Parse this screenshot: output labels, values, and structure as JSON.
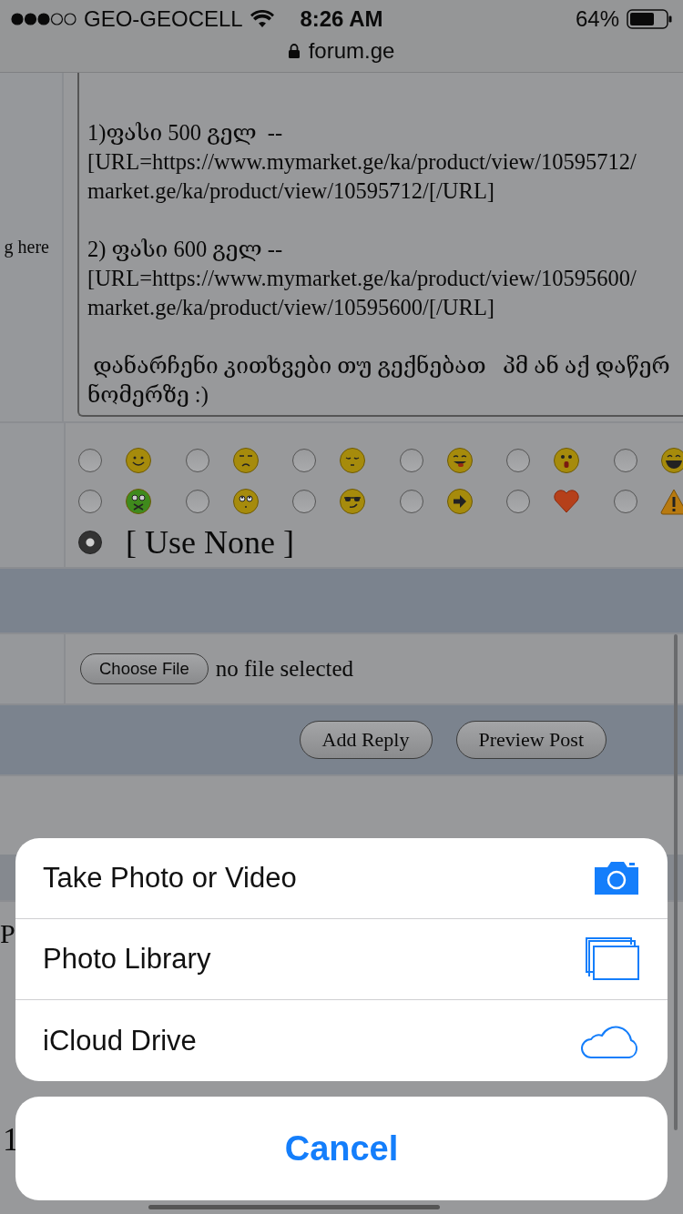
{
  "status_bar": {
    "carrier": "GEO-GEOCELL",
    "time": "8:26 AM",
    "battery": "64%",
    "url": "forum.ge"
  },
  "post_form": {
    "side_label": "g here",
    "message_lines": [
      {
        "kind": "blank"
      },
      {
        "kind": "line",
        "text": "1)ფასი 500 გელ  --"
      },
      {
        "kind": "line",
        "text": "[URL=https://www.mymarket.ge/ka/product/view/10595712/"
      },
      {
        "kind": "line",
        "text": "market.ge/ka/product/view/10595712/[/URL]"
      },
      {
        "kind": "blank"
      },
      {
        "kind": "line",
        "text": "2) ფასი 600 გელ --"
      },
      {
        "kind": "line",
        "text": "[URL=https://www.mymarket.ge/ka/product/view/10595600/"
      },
      {
        "kind": "line",
        "text": "market.ge/ka/product/view/10595600/[/URL]"
      },
      {
        "kind": "blank"
      },
      {
        "kind": "line",
        "text": " დანარჩენი კითხვები თუ გექნებათ   პმ ან აქ დაწერ"
      },
      {
        "kind": "line",
        "text": "ნომერზე :)"
      }
    ],
    "emoticons": [
      {
        "kind": "smile",
        "selected": false
      },
      {
        "kind": "frown",
        "selected": false
      },
      {
        "kind": "sleepy",
        "selected": false
      },
      {
        "kind": "tongue",
        "selected": false
      },
      {
        "kind": "shocked",
        "selected": false
      },
      {
        "kind": "grin",
        "selected": false
      },
      {
        "kind": "sick",
        "selected": false
      },
      {
        "kind": "rolleyes",
        "selected": false
      },
      {
        "kind": "cool",
        "selected": false
      },
      {
        "kind": "arrow",
        "selected": false
      },
      {
        "kind": "heart",
        "selected": false
      },
      {
        "kind": "warning",
        "selected": false
      }
    ],
    "use_none": {
      "label": "[ Use None ]",
      "selected": true
    },
    "attachment": {
      "button": "Choose File",
      "status": "no file selected"
    },
    "buttons": [
      "Add Reply",
      "Preview Post"
    ]
  },
  "page_below": {
    "row_fragment": "P",
    "number_fragment": "1"
  },
  "action_sheet": {
    "options": [
      {
        "kind": "camera",
        "label": "Take Photo or Video"
      },
      {
        "kind": "photos",
        "label": "Photo Library"
      },
      {
        "kind": "cloud",
        "label": "iCloud Drive"
      }
    ],
    "cancel": "Cancel"
  }
}
